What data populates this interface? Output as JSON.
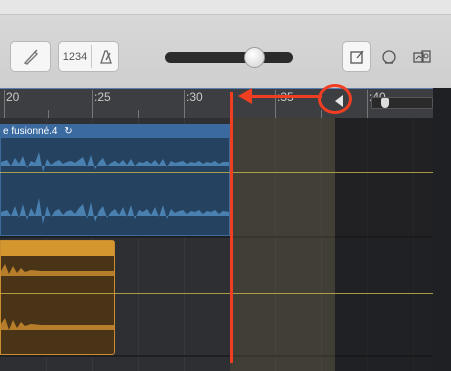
{
  "toolbar": {
    "lcd_text": "1234",
    "buttons": [
      "tuner",
      "count-in",
      "metronome",
      "note-pad",
      "loop-browser",
      "media-browser"
    ],
    "master_volume_level": 0.78
  },
  "ruler": {
    "labels": [
      "20",
      ":25",
      ":30",
      ":35",
      ":40"
    ]
  },
  "tracks": {
    "audio_region_name": "e fusionné.4",
    "audio_region_loop_symbol": "↻"
  },
  "colors": {
    "annotation": "#f03e23",
    "audio_region": "#3a6aa0",
    "midi_region": "#d4962f",
    "ruler_bg": "#3d3e42"
  }
}
